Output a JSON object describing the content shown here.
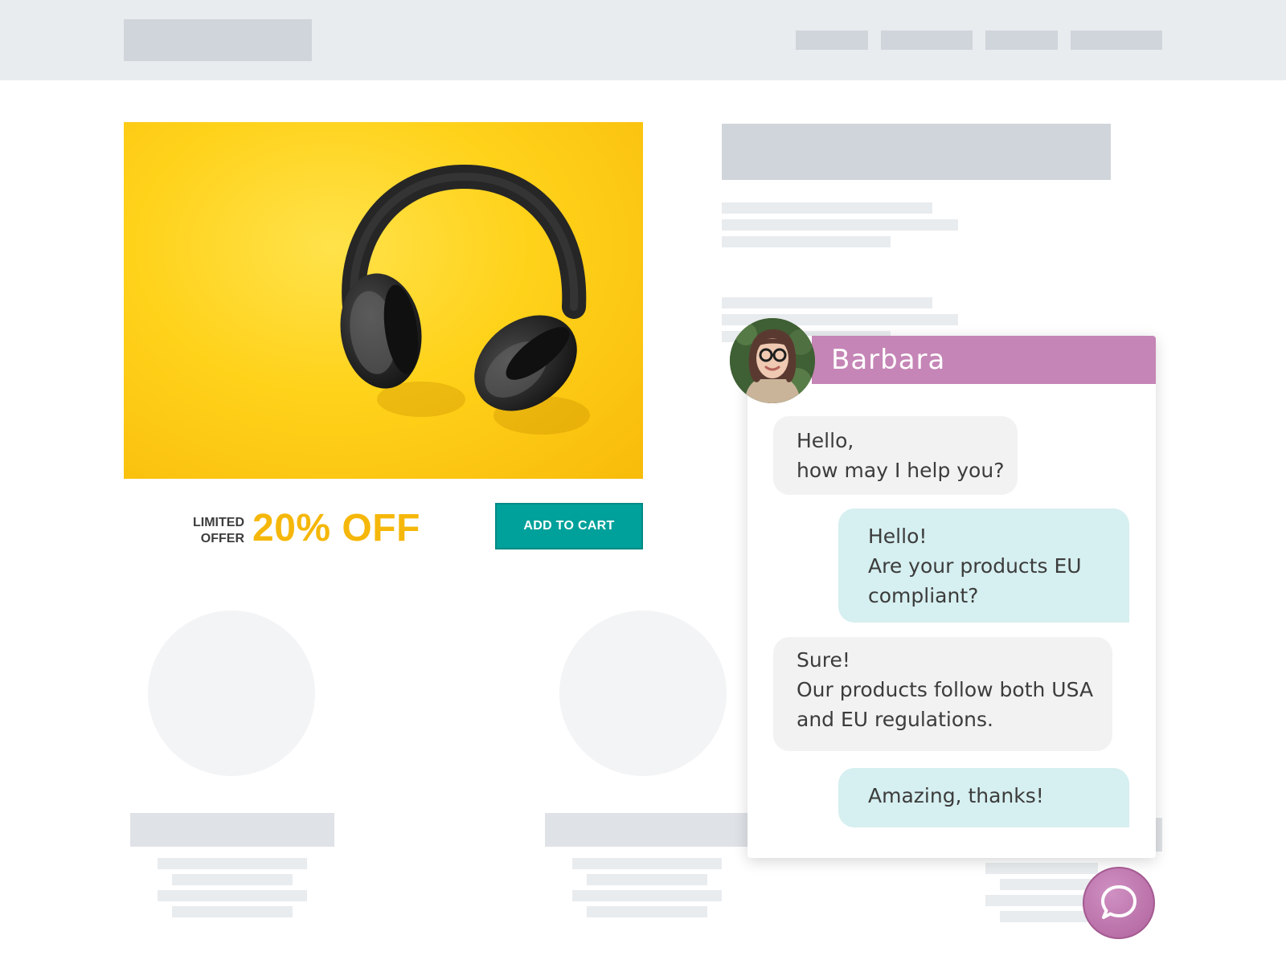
{
  "product": {
    "image_alt": "headphones-photo",
    "offer_label_line1": "LIMITED",
    "offer_label_line2": "OFFER",
    "discount": "20% OFF",
    "cart_button_label": "ADD TO CART"
  },
  "chat": {
    "agent_name": "Barbara",
    "messages": [
      {
        "from": "agent",
        "lines": [
          "Hello,",
          "how may I help you?"
        ]
      },
      {
        "from": "user",
        "lines": [
          "Hello!",
          "Are your products EU",
          "compliant?"
        ]
      },
      {
        "from": "agent",
        "lines": [
          "Sure!",
          "Our products follow both USA",
          "and EU regulations."
        ]
      },
      {
        "from": "user",
        "lines": [
          "Amazing, thanks!"
        ]
      }
    ],
    "launcher_icon": "chat-bubble-icon"
  },
  "colors": {
    "accent_teal": "#00a19a",
    "offer_yellow": "#f5b70a",
    "chat_purple": "#c585b6",
    "user_bubble": "#d6eff0",
    "agent_bubble": "#f3f2f2"
  }
}
